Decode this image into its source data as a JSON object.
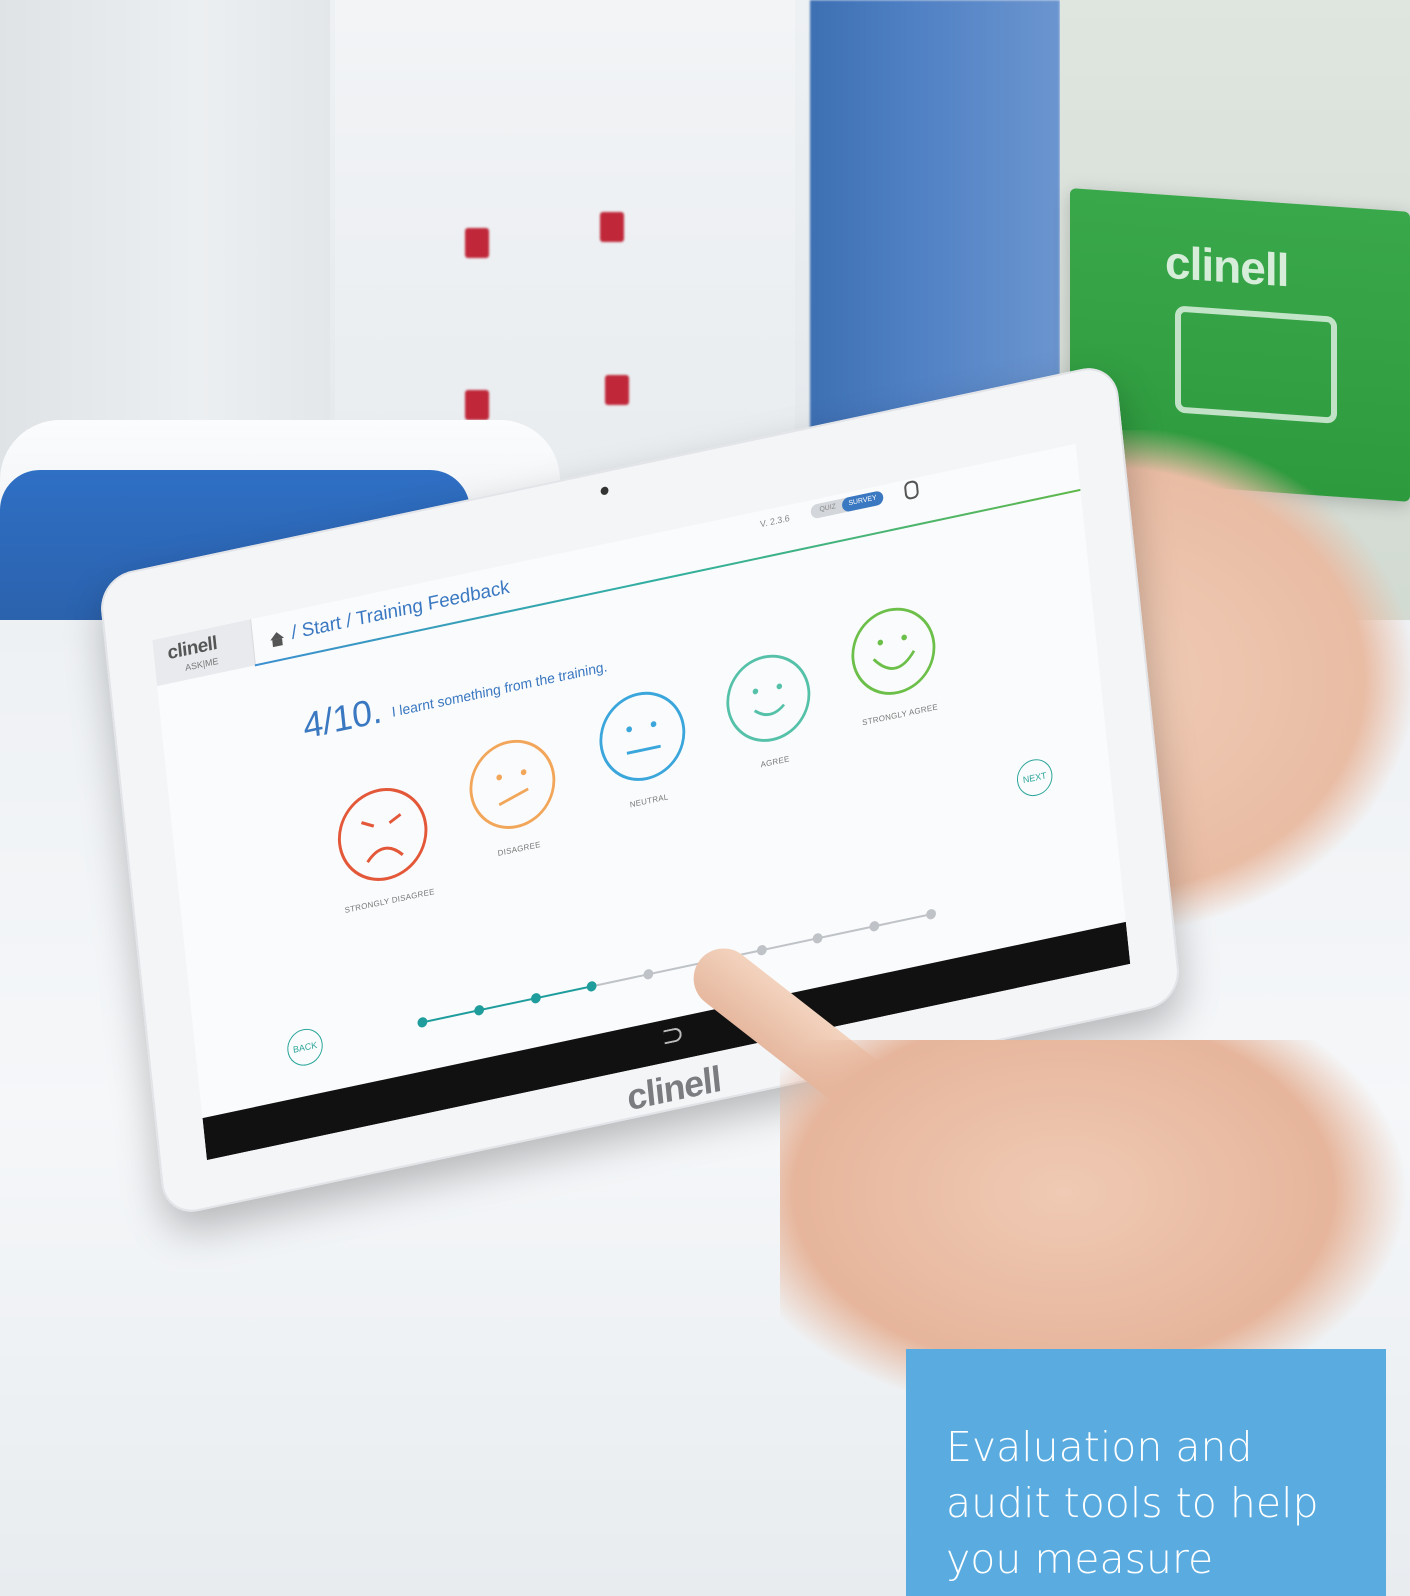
{
  "scene": {
    "box_logo": "clinell"
  },
  "tablet": {
    "brand": "clinell",
    "brand_sub": "ASK|ME",
    "breadcrumb": "/ Start / Training Feedback",
    "version": "V. 2.3.6",
    "mode_toggle": {
      "left": "QUIZ",
      "right": "SURVEY"
    },
    "question": {
      "number": "4/10.",
      "text": "I learnt something from the training."
    },
    "faces": [
      {
        "label": "STRONGLY DISAGREE",
        "color": "#e4583a",
        "mood": "very-sad"
      },
      {
        "label": "DISAGREE",
        "color": "#f2a65a",
        "mood": "sad"
      },
      {
        "label": "NEUTRAL",
        "color": "#3aa6db",
        "mood": "neutral"
      },
      {
        "label": "AGREE",
        "color": "#55c1a9",
        "mood": "happy"
      },
      {
        "label": "STRONGLY AGREE",
        "color": "#6cc04a",
        "mood": "very-happy"
      }
    ],
    "progress": {
      "current": 4,
      "total": 10
    },
    "back_label": "BACK",
    "next_label": "NEXT",
    "bezel_logo": "clinell"
  },
  "caption": {
    "text": "Evaluation and audit tools to help you measure"
  },
  "colors": {
    "accent_blue": "#3a78c1",
    "teal": "#1f9d9d",
    "caption_bg": "#5aace0"
  }
}
